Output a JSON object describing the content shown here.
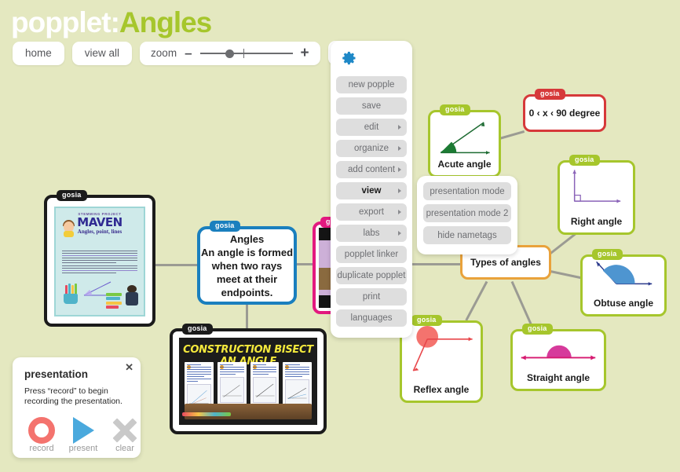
{
  "header": {
    "title_prefix": "popplet:",
    "title_name": "Angles",
    "home_label": "home",
    "view_all_label": "view all",
    "zoom_label": "zoom",
    "zoom_minus": "–",
    "zoom_plus": "+",
    "color_swatch": "#a8c833"
  },
  "menu": {
    "gear_icon": "gear-icon",
    "items": [
      {
        "label": "new popple",
        "arrow": false,
        "active": false
      },
      {
        "label": "save",
        "arrow": false,
        "active": false
      },
      {
        "label": "edit",
        "arrow": true,
        "active": false
      },
      {
        "label": "organize",
        "arrow": true,
        "active": false
      },
      {
        "label": "add content",
        "arrow": true,
        "active": false
      },
      {
        "label": "view",
        "arrow": true,
        "active": true
      },
      {
        "label": "export",
        "arrow": true,
        "active": false
      },
      {
        "label": "labs",
        "arrow": true,
        "active": false
      },
      {
        "label": "popplet linker",
        "arrow": false,
        "active": false
      },
      {
        "label": "duplicate popplet",
        "arrow": false,
        "active": false
      },
      {
        "label": "print",
        "arrow": false,
        "active": false
      },
      {
        "label": "languages",
        "arrow": false,
        "active": false
      }
    ]
  },
  "submenu": {
    "items": [
      {
        "label": "presentation mode"
      },
      {
        "label": "presentation mode 2"
      },
      {
        "label": "hide nametags"
      }
    ]
  },
  "dialog": {
    "close_icon": "✕",
    "title": "presentation",
    "body": "Press “record” to begin recording the presentation.",
    "buttons": [
      {
        "label": "record",
        "icon": "record-icon"
      },
      {
        "label": "present",
        "icon": "play-icon"
      },
      {
        "label": "clear",
        "icon": "clear-icon"
      }
    ]
  },
  "nametag": "gosia",
  "popples": {
    "angles": {
      "text": "Angles\nAn angle is formed when two rays meet at their endpoints.",
      "color": "#1a7fbe"
    },
    "types": {
      "text": "Types of angles",
      "color": "#e9a23b"
    },
    "range": {
      "text": "0 ‹ x ‹ 90 degree",
      "color": "#d6393a"
    },
    "acute": {
      "caption": "Acute angle",
      "color": "#a6c62c"
    },
    "right": {
      "caption": "Right angle",
      "color": "#a6c62c"
    },
    "obtuse": {
      "caption": "Obtuse angle",
      "color": "#a6c62c"
    },
    "reflex": {
      "caption": "Reflex angle",
      "color": "#a6c62c"
    },
    "straight": {
      "caption": "Straight angle",
      "color": "#a6c62c"
    },
    "maven": {
      "header": "STEMMING PROJECT",
      "logo": "MAVEN",
      "subtitle": "Angles, point, lines",
      "color": "#1b1b1b"
    },
    "bisect": {
      "title": "CONSTRUCTION BISECT AN ANGLE",
      "color": "#1b1b1b"
    },
    "pink": {
      "color": "#e3197f"
    }
  }
}
